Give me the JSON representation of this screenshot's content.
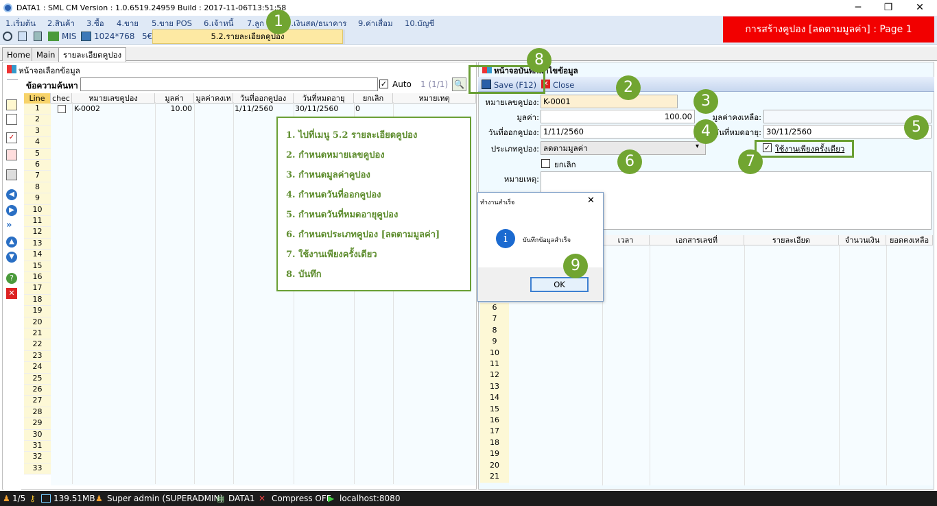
{
  "window": {
    "title": "DATA1 : SML CM Version : 1.0.6519.24959  Build : 2017-11-06T13:51:58",
    "minimize": "─",
    "restore": "❐",
    "close": "✕"
  },
  "menu": [
    "1.เริ่มต้น",
    "2.สินค้า",
    "3.ซื้อ",
    "4.ขาย",
    "5.ขาย POS",
    "6.เจ้าหนี้",
    "7.ลูก",
    "8.เงินสด/ธนาคาร",
    "9.ค่าเสื่อม",
    "10.บัญชี"
  ],
  "toolbar": {
    "mis": "MIS",
    "resolution": "1024*768",
    "extra": "5€",
    "tab_label": "5.2.รายละเอียดคูปอง"
  },
  "banner": "การสร้างคูปอง [ลดตามมูลค่า] : Page 1",
  "tabs": [
    "Home",
    "Main",
    "รายละเอียดคูปอง"
  ],
  "left": {
    "panel_title": "หน้าจอเลือกข้อมูล",
    "search_label": "ข้อความค้นหา",
    "search_value": "",
    "auto_label": "Auto",
    "page_count": "1 (1/1)",
    "columns": [
      "Line",
      "chec",
      "หมายเลขคูปอง",
      "มูลค่า",
      "มูลค่าคงเห",
      "วันที่ออกคูปอง",
      "วันที่หมดอายุ",
      "ยกเลิก",
      "หมายเหตุ"
    ],
    "rows": [
      {
        "line": "1",
        "code": "K-0002",
        "value": "10.00",
        "issue": "1/11/2560",
        "expire": "30/11/2560",
        "cancel": "0"
      }
    ],
    "row_count": 33
  },
  "right": {
    "panel_title": "หน้าจอบันทึกแก้ไขข้อมูล",
    "save": "Save (F12)",
    "close": "Close",
    "code_label": "หมายเลขคูปอง:",
    "code_value": "K-0001",
    "value_label": "มูลค่า:",
    "value_value": "100.00",
    "balance_label": "มูลค่าคงเหลือ:",
    "balance_value": "",
    "issue_label": "วันที่ออกคูปอง:",
    "issue_value": "1/11/2560",
    "expire_label": "วันที่หมดอายุ:",
    "expire_value": "30/11/2560",
    "type_label": "ประเภทคูปอง:",
    "type_value": "ลดตามมูลค่า",
    "once_label": "ใช้งานเพียงครั้งเดียว",
    "cancel_label": "ยกเลิก",
    "note_label": "หมายเหตุ:",
    "columns": [
      "เวลา",
      "เอกสารเลขที่",
      "รายละเอียด",
      "จำนวนเงิน",
      "ยอดคงเหลือ"
    ],
    "row_numbers": [
      "6",
      "7",
      "8",
      "9",
      "10",
      "11",
      "12",
      "13",
      "14",
      "15",
      "16",
      "17",
      "18",
      "19",
      "20",
      "21"
    ]
  },
  "dialog": {
    "title": "ทำงานสำเร็จ",
    "message": "บันทึกข้อมูลสำเร็จ",
    "ok": "OK",
    "close": "✕"
  },
  "instructions": [
    "1. ไปที่เมนู 5.2 รายละเอียดคูปอง",
    "2. กำหนดหมายเลขคูปอง",
    "3. กำหนดมูลค่าคูปอง",
    "4. กำหนดวันที่ออกคูปอง",
    "5. กำหนดวันที่หมดอายุคูปอง",
    "6. กำหนดประเภทคูปอง [ลดตามมูลค่า]",
    "7. ใช้งานเพียงครั้งเดียว",
    "8. บันทึก"
  ],
  "badges": [
    "1",
    "2",
    "3",
    "4",
    "5",
    "6",
    "7",
    "8",
    "9"
  ],
  "status": {
    "page": "1/5",
    "memory": "139.51MB",
    "user": "Super admin (SUPERADMIN)",
    "db": "DATA1",
    "compress": "Compress OFF",
    "host": "localhost:8080"
  },
  "colors": {
    "accent": "#dfe9f6",
    "banner": "#f20000",
    "badge": "#71a531",
    "status_bg": "#1c1c1c"
  }
}
